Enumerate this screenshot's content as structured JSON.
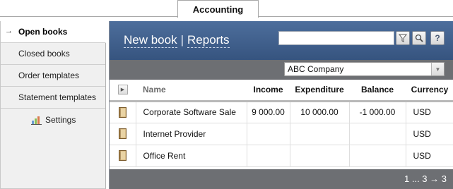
{
  "top_tab": {
    "label": "Accounting"
  },
  "sidebar": {
    "items": [
      {
        "label": "Open books",
        "active": true
      },
      {
        "label": "Closed books"
      },
      {
        "label": "Order templates"
      },
      {
        "label": "Statement templates"
      }
    ],
    "sub_item": {
      "label": "Settings",
      "icon": "chart-icon"
    },
    "active_marker": "→"
  },
  "header": {
    "new_book_label": "New book",
    "separator": "|",
    "reports_label": "Reports",
    "search_value": "",
    "icons": [
      "filter-icon",
      "search-icon",
      "help-icon"
    ],
    "help_glyph": "?"
  },
  "company": {
    "selected": "ABC Company"
  },
  "table": {
    "columns": [
      "",
      "Name",
      "Income",
      "Expenditure",
      "Balance",
      "Currency"
    ],
    "rows": [
      {
        "name": "Corporate Software Sale",
        "income": "9 000.00",
        "expenditure": "10 000.00",
        "balance": "-1 000.00",
        "currency": "USD"
      },
      {
        "name": "Internet Provider",
        "income": "",
        "expenditure": "",
        "balance": "",
        "currency": "USD"
      },
      {
        "name": "Office Rent",
        "income": "",
        "expenditure": "",
        "balance": "",
        "currency": "USD"
      }
    ]
  },
  "footer": {
    "pager_text": "1 ... 3 → 3"
  },
  "colors": {
    "header_top": "#4d6e9c",
    "header_bottom": "#36547f",
    "bar_gray": "#6d6f73",
    "sidebar_bg": "#f0f0f0"
  }
}
